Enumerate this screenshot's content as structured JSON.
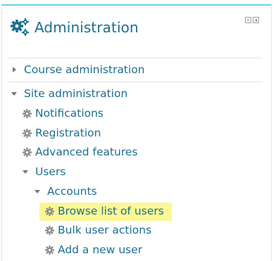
{
  "block": {
    "title": "Administration",
    "icon": "cogs-icon",
    "controls": [
      "minimize-icon",
      "dock-icon"
    ]
  },
  "tree": {
    "course_admin": "Course administration",
    "site_admin": "Site administration",
    "notifications": "Notifications",
    "registration": "Registration",
    "advanced_features": "Advanced features",
    "users": "Users",
    "accounts": "Accounts",
    "browse_users": "Browse list of users",
    "bulk_user_actions": "Bulk user actions",
    "add_new_user": "Add a new user"
  },
  "colors": {
    "link": "#1c6f8e",
    "highlight": "#fbf795",
    "top_border": "#6fd0e3"
  }
}
